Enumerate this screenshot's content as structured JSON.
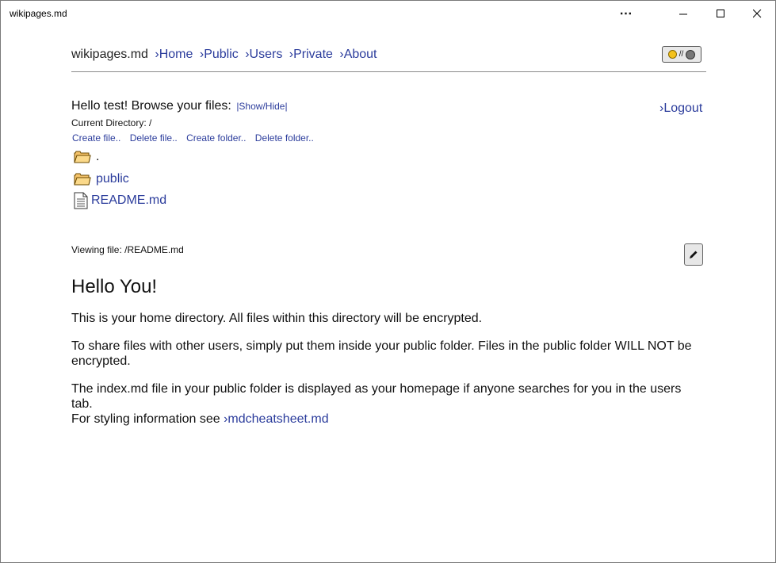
{
  "window": {
    "title": "wikipages.md",
    "more_label": "⋯"
  },
  "nav": {
    "brand": "wikipages.md",
    "links": [
      "›Home",
      "›Public",
      "›Users",
      "›Private",
      "›About"
    ],
    "theme_toggle": {
      "separator": "//",
      "icons": [
        "sun-icon",
        "moon-icon"
      ]
    }
  },
  "browser": {
    "greeting": "Hello test! Browse your files:",
    "show_hide": "|Show/Hide|",
    "logout": "›Logout",
    "current_directory": "Current Directory: /",
    "actions": [
      "Create file..",
      "Delete file..",
      "Create folder..",
      "Delete folder.."
    ],
    "entries": [
      {
        "name": ".",
        "type": "folder"
      },
      {
        "name": "public",
        "type": "folder"
      },
      {
        "name": "README.md",
        "type": "file"
      }
    ]
  },
  "viewer": {
    "viewing": "Viewing file: /README.md",
    "heading": "Hello You!",
    "paragraphs": [
      "This is your home directory. All files within this directory will be encrypted.",
      "To share files with other users, simply put them inside your public folder. Files in the public folder WILL NOT be encrypted.",
      "The index.md file in your public folder is displayed as your homepage if anyone searches for you in the users tab."
    ],
    "styling_prefix": "For styling information see",
    "styling_link": "›mdcheatsheet.md"
  },
  "colors": {
    "link": "#2b3c9c",
    "folder": "#f5c36a"
  }
}
